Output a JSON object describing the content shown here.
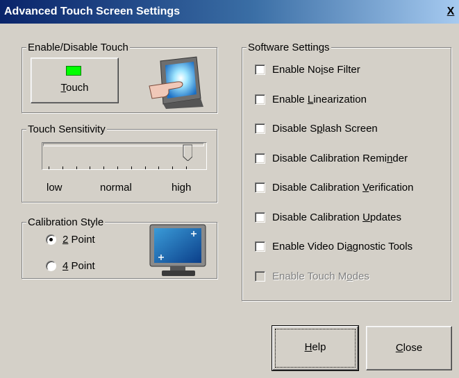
{
  "window": {
    "title": "Advanced Touch Screen Settings",
    "close_glyph": "X"
  },
  "touch_group": {
    "legend": "Enable/Disable Touch",
    "button_label": "Touch",
    "status_color": "#00ff00",
    "icon": "touch-screen-hand-icon"
  },
  "sensitivity_group": {
    "legend": "Touch Sensitivity",
    "low_label": "low",
    "normal_label": "normal",
    "high_label": "high",
    "level": "high",
    "tick_count": 11
  },
  "calibration_group": {
    "legend": "Calibration Style",
    "options": [
      {
        "label": "2 Point",
        "selected": true
      },
      {
        "label": "4 Point",
        "selected": false
      }
    ],
    "icon": "monitor-calibration-icon"
  },
  "software_group": {
    "legend": "Software Settings",
    "options": [
      {
        "label": "Enable Noise Filter",
        "checked": false,
        "enabled": true
      },
      {
        "label": "Enable Linearization",
        "checked": false,
        "enabled": true
      },
      {
        "label": "Disable Splash Screen",
        "checked": false,
        "enabled": true
      },
      {
        "label": "Disable Calibration Reminder",
        "checked": false,
        "enabled": true
      },
      {
        "label": "Disable Calibration Verification",
        "checked": false,
        "enabled": true
      },
      {
        "label": "Disable Calibration Updates",
        "checked": false,
        "enabled": true
      },
      {
        "label": "Enable Video Diagnostic Tools",
        "checked": false,
        "enabled": true
      },
      {
        "label": "Enable Touch Modes",
        "checked": false,
        "enabled": false
      }
    ]
  },
  "buttons": {
    "help": "Help",
    "close": "Close"
  },
  "colors": {
    "dialog_bg": "#d4d0c8",
    "title_start": "#0a246a",
    "title_end": "#a6caf0"
  }
}
